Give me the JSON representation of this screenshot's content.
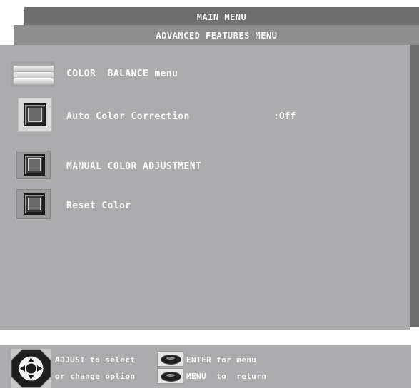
{
  "header": {
    "main_menu_title": "MAIN MENU",
    "advanced_title": "ADVANCED FEATURES MENU"
  },
  "menu": {
    "items": [
      {
        "label": "COLOR  BALANCE menu",
        "icon": "color-balance-icon"
      },
      {
        "label": "Auto Color Correction",
        "value": ":Off",
        "icon": "square-button-icon",
        "selected": true
      },
      {
        "label": "MANUAL COLOR ADJUSTMENT",
        "icon": "square-button-icon"
      },
      {
        "label": "Reset Color",
        "icon": "square-button-icon"
      }
    ]
  },
  "footer": {
    "adjust_line1": "ADJUST to select",
    "adjust_line2": "or change option",
    "enter_line": "ENTER for menu",
    "menu_line": "MENU  to  return",
    "icons": [
      "dpad-icon",
      "enter-button-icon",
      "menu-button-icon"
    ]
  },
  "colors": {
    "panel": "#acacaf",
    "main_bar": "#6f6f6f",
    "advanced_bar": "#8e8e8e",
    "shadow": "#6d6d6d",
    "text": "#f6f6f6"
  }
}
